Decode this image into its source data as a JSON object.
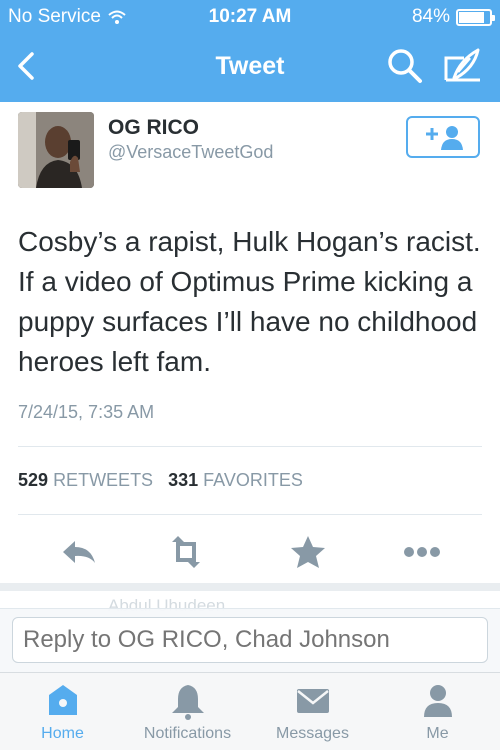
{
  "status_bar": {
    "carrier": "No Service",
    "time": "10:27 AM",
    "battery": "84%",
    "battery_level": 0.84
  },
  "nav": {
    "title": "Tweet"
  },
  "tweet": {
    "name": "OG RICO",
    "handle": "@VersaceTweetGod",
    "text": "Cosby’s a rapist, Hulk Hogan’s racist. If a video of Optimus Prime kicking a puppy surfaces I’ll have no childhood heroes left fam.",
    "timestamp": "7/24/15, 7:35 AM",
    "retweet_count": "529",
    "retweets_label": "RETWEETS",
    "favorite_count": "331",
    "favorites_label": "FAVORITES"
  },
  "reply_ghost": "Abdul Uhudeen",
  "reply": {
    "placeholder": "Reply to OG RICO, Chad Johnson"
  },
  "tabs": [
    {
      "label": "Home",
      "icon": "home-icon",
      "active": true
    },
    {
      "label": "Notifications",
      "icon": "bell-icon",
      "active": false
    },
    {
      "label": "Messages",
      "icon": "envelope-icon",
      "active": false
    },
    {
      "label": "Me",
      "icon": "person-icon",
      "active": false
    }
  ],
  "colors": {
    "brand": "#55acee",
    "text": "#292f33",
    "muted": "#8899a6",
    "action_icon": "#8899a6"
  }
}
